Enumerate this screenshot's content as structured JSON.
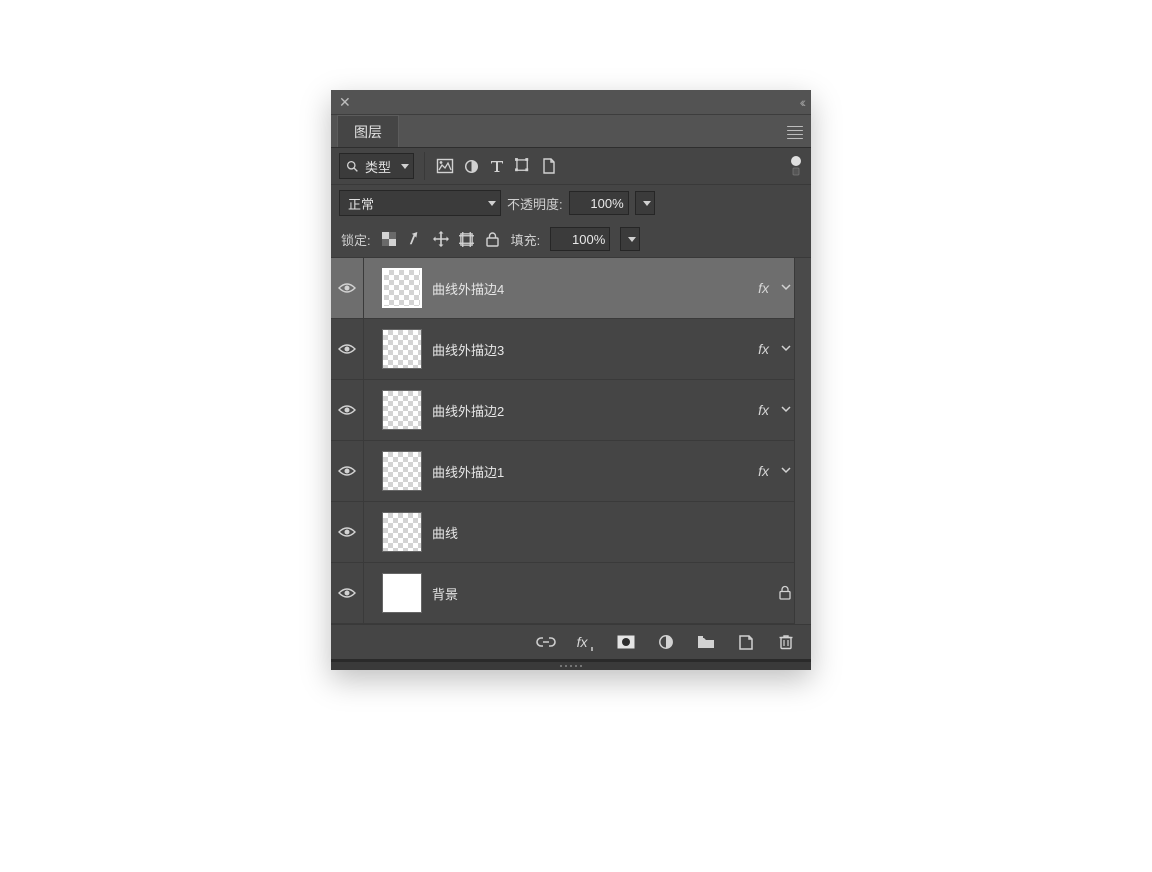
{
  "panel_title": "图层",
  "filter": {
    "kind": "类型"
  },
  "blend": {
    "mode": "正常",
    "opacity_label": "不透明度:",
    "opacity_value": "100%"
  },
  "lock": {
    "label": "锁定:",
    "fill_label": "填充:",
    "fill_value": "100%"
  },
  "layers": [
    {
      "name": "曲线外描边4",
      "visible": true,
      "fx": true,
      "selected": true,
      "thumb": "checker"
    },
    {
      "name": "曲线外描边3",
      "visible": true,
      "fx": true,
      "selected": false,
      "thumb": "checker"
    },
    {
      "name": "曲线外描边2",
      "visible": true,
      "fx": true,
      "selected": false,
      "thumb": "checker"
    },
    {
      "name": "曲线外描边1",
      "visible": true,
      "fx": true,
      "selected": false,
      "thumb": "checker"
    },
    {
      "name": "曲线",
      "visible": true,
      "fx": false,
      "selected": false,
      "thumb": "checker"
    },
    {
      "name": "背景",
      "visible": true,
      "fx": false,
      "selected": false,
      "thumb": "white",
      "locked": true
    }
  ],
  "icons": {
    "fx": "fx"
  }
}
